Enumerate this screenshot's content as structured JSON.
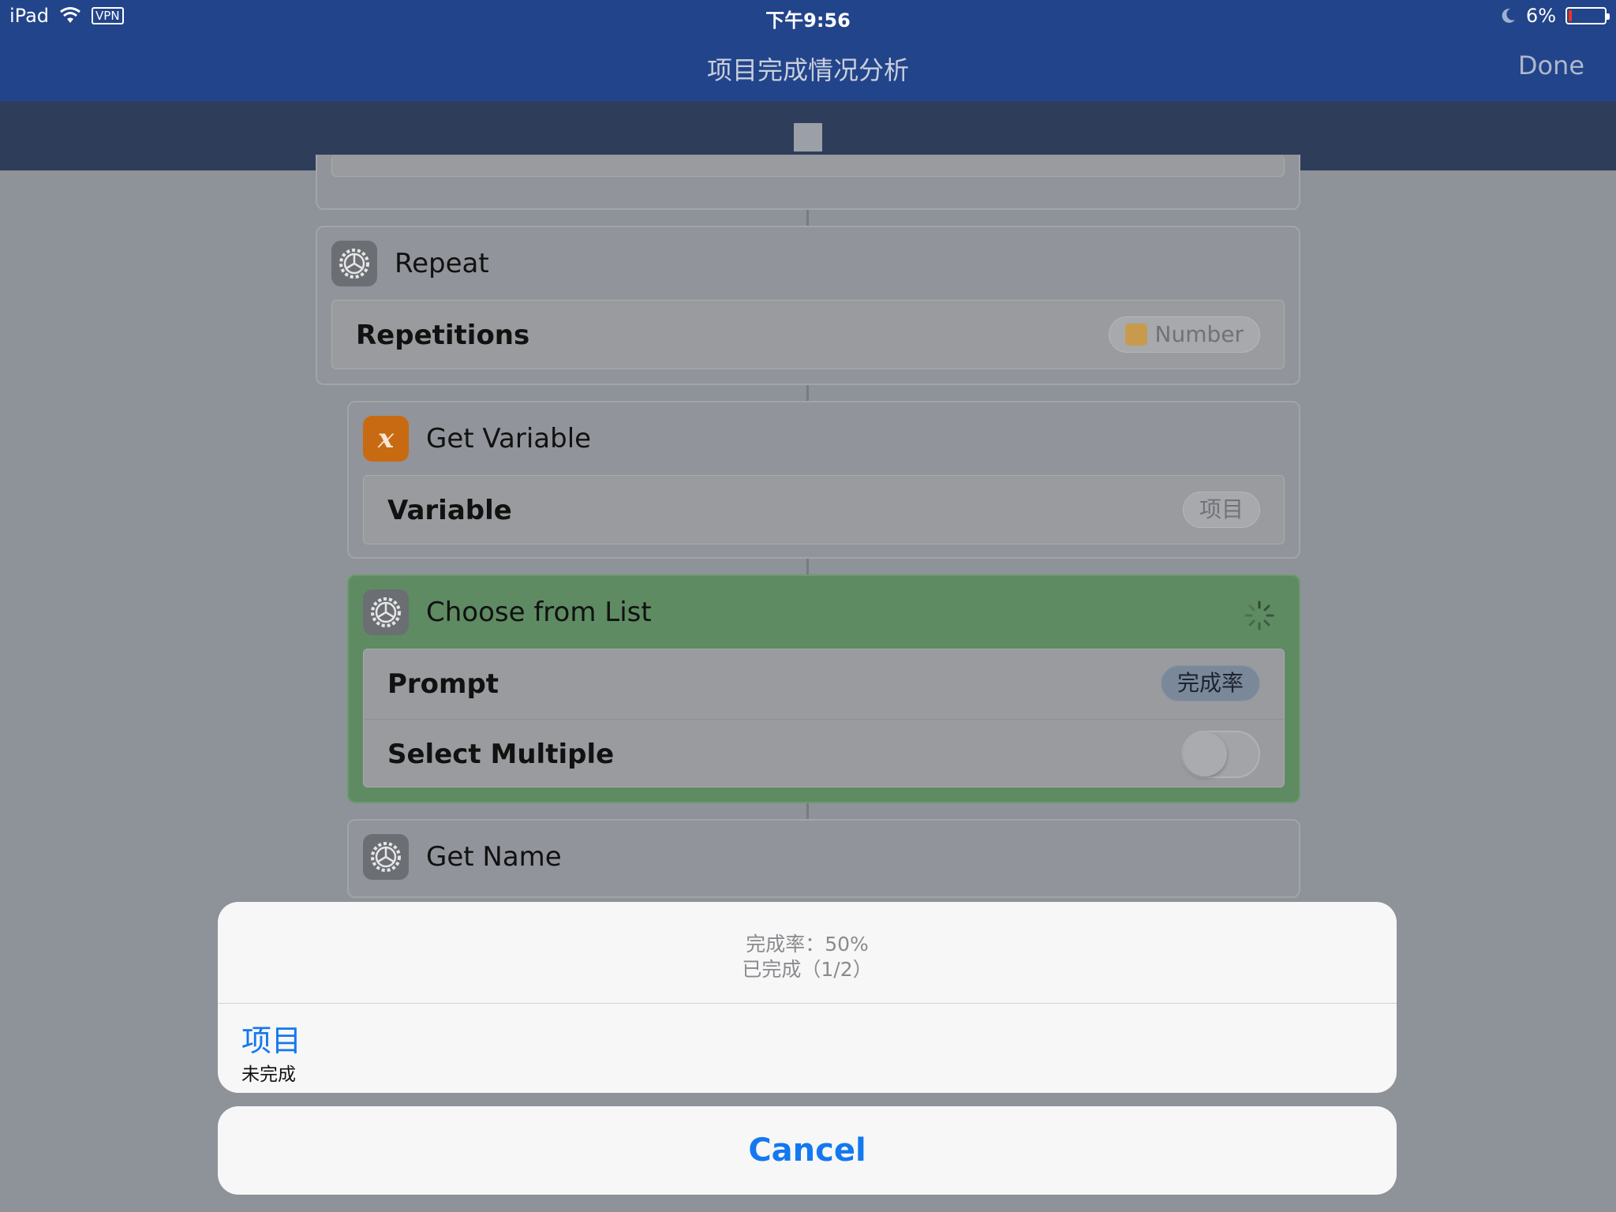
{
  "status_bar": {
    "device": "iPad",
    "vpn": "VPN",
    "time": "下午9:56",
    "battery": "6%"
  },
  "nav": {
    "title": "项目完成情况分析",
    "done_label": "Done"
  },
  "workflow": {
    "repeat": {
      "title": "Repeat",
      "param_label": "Repetitions",
      "param_value": "Number"
    },
    "get_variable": {
      "title": "Get Variable",
      "param_label": "Variable",
      "param_value": "项目"
    },
    "choose_from_list": {
      "title": "Choose from List",
      "prompt_label": "Prompt",
      "prompt_value": "完成率",
      "select_multiple_label": "Select Multiple",
      "select_multiple_on": false
    },
    "get_name": {
      "title": "Get Name"
    }
  },
  "action_sheet": {
    "message_line1": "完成率：50%",
    "message_line2": "已完成（1/2）",
    "items": [
      {
        "title": "项目",
        "subtitle": "未完成"
      }
    ],
    "cancel_label": "Cancel"
  },
  "colors": {
    "nav_bar": "#22448a",
    "toolbar": "#2e3d59",
    "accent": "#1478ef",
    "running_action": "#5e8b62"
  }
}
